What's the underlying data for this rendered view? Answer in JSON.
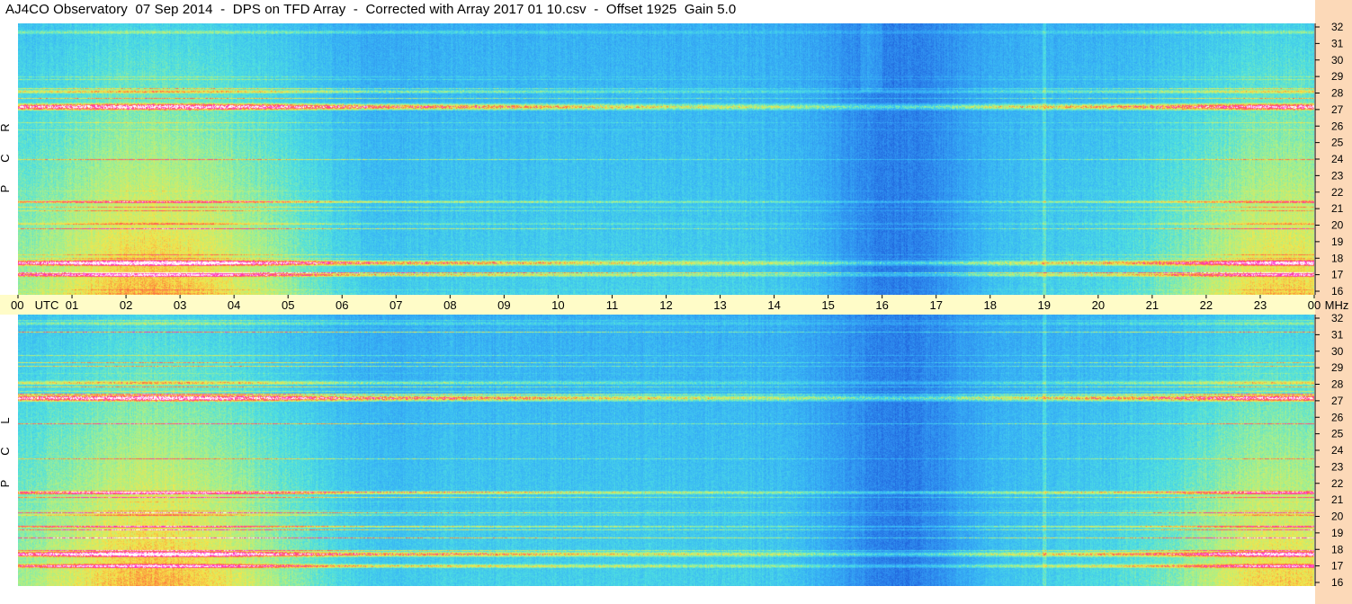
{
  "title": "AJ4CO Observatory  07 Sep 2014  -  DPS on TFD Array  -  Corrected with Array 2017 01 10.csv  -  Offset 1925  Gain 5.0",
  "colors": {
    "background": "#ffffff",
    "utc_bar": "#fffcc8",
    "freq_strip": "#fcd9b8",
    "spectrogram_base": "#1e5bd8"
  },
  "chart_data": {
    "type": "heatmap",
    "time_axis": {
      "unit_label": "UTC",
      "ticks": [
        "00",
        "01",
        "02",
        "03",
        "04",
        "05",
        "06",
        "07",
        "08",
        "09",
        "10",
        "11",
        "12",
        "13",
        "14",
        "15",
        "16",
        "17",
        "18",
        "19",
        "20",
        "21",
        "22",
        "23",
        "00"
      ],
      "range_hours": [
        0,
        24
      ]
    },
    "freq_axis": {
      "unit_label": "MHz",
      "ticks": [
        "32",
        "31",
        "30",
        "29",
        "28",
        "27",
        "26",
        "25",
        "24",
        "23",
        "22",
        "21",
        "20",
        "19",
        "18",
        "17",
        "16"
      ],
      "range_mhz": [
        16,
        32
      ]
    },
    "panels": [
      {
        "name": "RCP",
        "letters": [
          "R",
          "C",
          "P"
        ]
      },
      {
        "name": "LCP",
        "letters": [
          "L",
          "C",
          "P"
        ]
      }
    ],
    "colormap": [
      "#00188a",
      "#0030c0",
      "#1e5bd8",
      "#2f8ff0",
      "#39b8f5",
      "#4fe0e0",
      "#a8f08a",
      "#f5e64a",
      "#ff6a3a",
      "#ff2ad0",
      "#ffffff"
    ]
  }
}
